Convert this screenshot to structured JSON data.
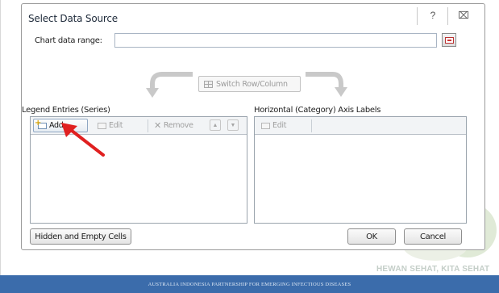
{
  "dialog": {
    "title": "Select Data Source",
    "help_glyph": "?",
    "close_glyph": "⌧"
  },
  "chart_range": {
    "label": "Chart data range:",
    "value": ""
  },
  "switch_button_label": "Switch Row/Column",
  "legend_panel": {
    "heading": "Legend Entries (Series)",
    "add_label": "Add",
    "edit_label": "Edit",
    "remove_label": "Remove",
    "up_glyph": "▲",
    "down_glyph": "▼",
    "items": []
  },
  "axis_panel": {
    "heading": "Horizontal (Category) Axis Labels",
    "edit_label": "Edit",
    "items": []
  },
  "buttons": {
    "hidden_empty": "Hidden and Empty Cells",
    "ok": "OK",
    "cancel": "Cancel"
  },
  "watermark_text": "HEWAN SEHAT, KITA SEHAT",
  "footer_text": "AUSTRALIA INDONESIA PARTNERSHIP FOR EMERGING INFECTIOUS DISEASES",
  "colors": {
    "footer": "#3b6cab",
    "annotation_arrow": "#e02020"
  }
}
